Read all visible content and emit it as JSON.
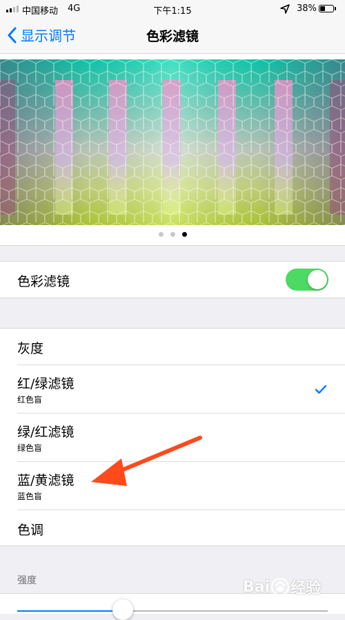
{
  "status_bar": {
    "carrier": "中国移动",
    "network": "4G",
    "time": "下午1:15",
    "battery_percent": "38%",
    "battery_level": 0.38,
    "icons": [
      "signal-icon",
      "location-icon",
      "battery-icon"
    ]
  },
  "nav": {
    "back_label": "显示调节",
    "title": "色彩滤镜"
  },
  "preview": {
    "page_count": 3,
    "active_page": 3
  },
  "toggle": {
    "label": "色彩滤镜",
    "on": true,
    "on_color": "#4cd964"
  },
  "filters": [
    {
      "title": "灰度",
      "subtitle": "",
      "selected": false
    },
    {
      "title": "红/绿滤镜",
      "subtitle": "红色盲",
      "selected": true
    },
    {
      "title": "绿/红滤镜",
      "subtitle": "绿色盲",
      "selected": false
    },
    {
      "title": "蓝/黄滤镜",
      "subtitle": "蓝色盲",
      "selected": false
    },
    {
      "title": "色调",
      "subtitle": "",
      "selected": false
    }
  ],
  "intensity": {
    "header": "强度",
    "value": 0.34
  },
  "colors": {
    "accent": "#007aff",
    "annotation_arrow": "#ff4a1c"
  },
  "watermark": {
    "text_left": "Bai",
    "text_right": "经验"
  }
}
